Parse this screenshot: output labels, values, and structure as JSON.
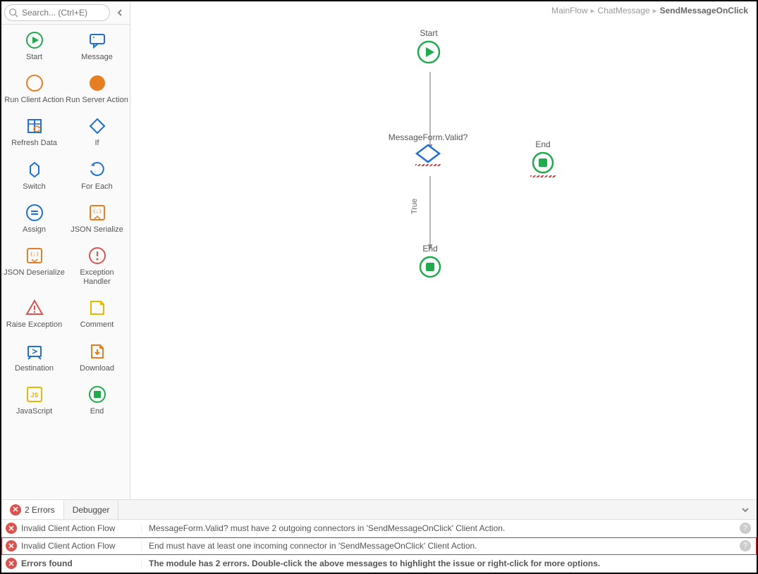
{
  "search": {
    "placeholder": "Search... (Ctrl+E)"
  },
  "breadcrumb": {
    "items": [
      "MainFlow",
      "ChatMessage"
    ],
    "current": "SendMessageOnClick"
  },
  "palette": [
    {
      "label": "Start",
      "icon": "start"
    },
    {
      "label": "Message",
      "icon": "message"
    },
    {
      "label": "Run Client Action",
      "icon": "run-client"
    },
    {
      "label": "Run Server Action",
      "icon": "run-server"
    },
    {
      "label": "Refresh Data",
      "icon": "refresh-data"
    },
    {
      "label": "If",
      "icon": "if"
    },
    {
      "label": "Switch",
      "icon": "switch"
    },
    {
      "label": "For Each",
      "icon": "for-each"
    },
    {
      "label": "Assign",
      "icon": "assign"
    },
    {
      "label": "JSON Serialize",
      "icon": "json-ser"
    },
    {
      "label": "JSON Deserialize",
      "icon": "json-deser"
    },
    {
      "label": "Exception Handler",
      "icon": "exc-handler"
    },
    {
      "label": "Raise Exception",
      "icon": "raise-exc"
    },
    {
      "label": "Comment",
      "icon": "comment"
    },
    {
      "label": "Destination",
      "icon": "destination"
    },
    {
      "label": "Download",
      "icon": "download"
    },
    {
      "label": "JavaScript",
      "icon": "javascript"
    },
    {
      "label": "End",
      "icon": "end"
    }
  ],
  "flow": {
    "start": {
      "label": "Start"
    },
    "if": {
      "label": "MessageForm.Valid?",
      "edgeTrue": "True"
    },
    "endTrue": {
      "label": "End"
    },
    "endSide": {
      "label": "End"
    }
  },
  "tabs": {
    "errors": "2 Errors",
    "debugger": "Debugger"
  },
  "errors": [
    {
      "title": "Invalid Client Action Flow",
      "msg": "MessageForm.Valid? must have 2 outgoing connectors in 'SendMessageOnClick' Client Action.",
      "help": true
    },
    {
      "title": "Invalid Client Action Flow",
      "msg": "End must have at least one incoming connector in 'SendMessageOnClick' Client Action.",
      "help": true,
      "highlight": true
    },
    {
      "title": "Errors found",
      "msg": "The module has 2 errors. Double-click the above messages to highlight the issue or right-click for more options.",
      "bold": true
    }
  ]
}
